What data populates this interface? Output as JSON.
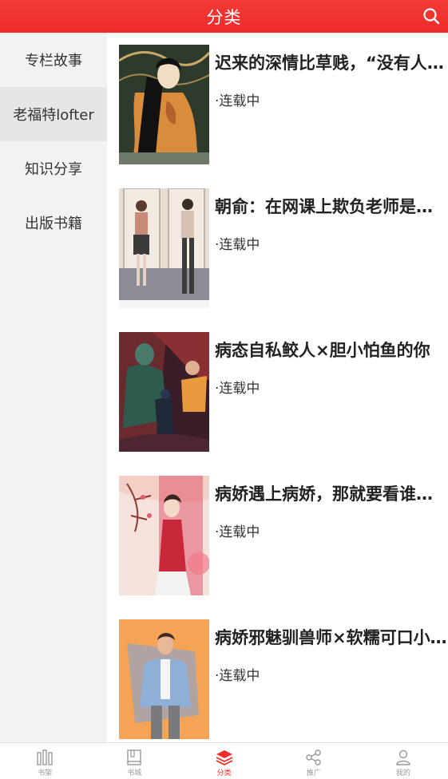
{
  "header": {
    "title": "分类",
    "search_icon": "search-icon"
  },
  "sidebar": {
    "items": [
      {
        "label": "专栏故事",
        "active": false
      },
      {
        "label": "老福特lofter",
        "active": true
      },
      {
        "label": "知识分享",
        "active": false
      },
      {
        "label": "出版书籍",
        "active": false
      }
    ]
  },
  "books": [
    {
      "title": "迟来的深情比草贱，“没有人爱我了”",
      "status": "·连载中"
    },
    {
      "title": "朝俞：在网课上欺负老师是什么体验",
      "status": "·连载中"
    },
    {
      "title": "病态自私鲛人×胆小怕鱼的你",
      "status": "·连载中"
    },
    {
      "title": "病娇遇上病娇，那就要看谁更病娇了",
      "status": "·连载中"
    },
    {
      "title": "病娇邪魅驯兽师×软糯可口小兔子",
      "status": "·连载中"
    }
  ],
  "tabbar": {
    "tabs": [
      {
        "label": "书架",
        "icon": "bookshelf-icon"
      },
      {
        "label": "书城",
        "icon": "book-icon"
      },
      {
        "label": "分类",
        "icon": "layers-icon",
        "active": true
      },
      {
        "label": "推广",
        "icon": "share-icon"
      },
      {
        "label": "我的",
        "icon": "user-icon"
      }
    ]
  },
  "colors": {
    "accent": "#ee2c2a",
    "sidebar_bg": "#f2f2f2",
    "sidebar_active_bg": "#e6e6e6"
  }
}
